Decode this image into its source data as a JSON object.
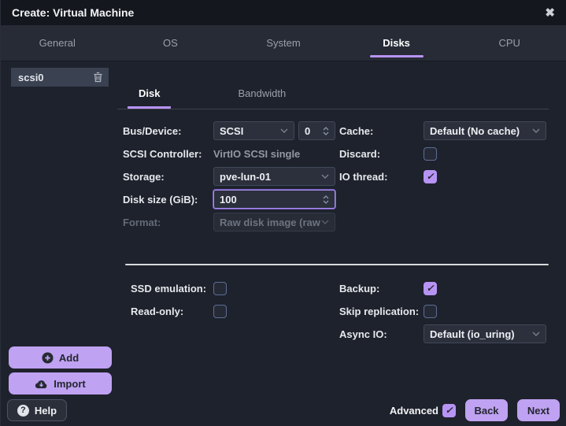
{
  "window": {
    "title": "Create: Virtual Machine"
  },
  "colors": {
    "accent": "#b794f4",
    "button_bg": "#bfa2f2",
    "titlebar_bg": "#14171e",
    "tabbar_bg": "#272b35",
    "content_bg": "#1e222c",
    "checkbox_checked": "#b794f4"
  },
  "icons": {
    "close": "✖",
    "check": "✓",
    "question": "?"
  },
  "tabs": [
    {
      "label": "General",
      "active": false
    },
    {
      "label": "OS",
      "active": false
    },
    {
      "label": "System",
      "active": false
    },
    {
      "label": "Disks",
      "active": true
    },
    {
      "label": "CPU",
      "active": false
    }
  ],
  "sidebar": {
    "items": [
      {
        "label": "scsi0",
        "selected": true
      }
    ]
  },
  "inner_tabs": [
    {
      "label": "Disk",
      "active": true
    },
    {
      "label": "Bandwidth",
      "active": false
    }
  ],
  "form": {
    "bus_device": {
      "label": "Bus/Device:",
      "value": "SCSI",
      "number": "0"
    },
    "scsi_controller": {
      "label": "SCSI Controller:",
      "value": "VirtIO SCSI single"
    },
    "storage": {
      "label": "Storage:",
      "value": "pve-lun-01"
    },
    "disk_size": {
      "label": "Disk size (GiB):",
      "value": "100",
      "focused": true
    },
    "format": {
      "label": "Format:",
      "value": "Raw disk image (raw",
      "disabled": true
    },
    "cache": {
      "label": "Cache:",
      "value": "Default (No cache)"
    },
    "discard": {
      "label": "Discard:",
      "checked": false
    },
    "io_thread": {
      "label": "IO thread:",
      "checked": true
    }
  },
  "advanced_section": {
    "ssd_emulation": {
      "label": "SSD emulation:",
      "checked": false
    },
    "read_only": {
      "label": "Read-only:",
      "checked": false
    },
    "backup": {
      "label": "Backup:",
      "checked": true
    },
    "skip_replication": {
      "label": "Skip replication:",
      "checked": false
    },
    "async_io": {
      "label": "Async IO:",
      "value": "Default (io_uring)"
    }
  },
  "buttons": {
    "add": "Add",
    "import": "Import",
    "help": "Help",
    "advanced": "Advanced",
    "advanced_checked": true,
    "back": "Back",
    "next": "Next"
  }
}
